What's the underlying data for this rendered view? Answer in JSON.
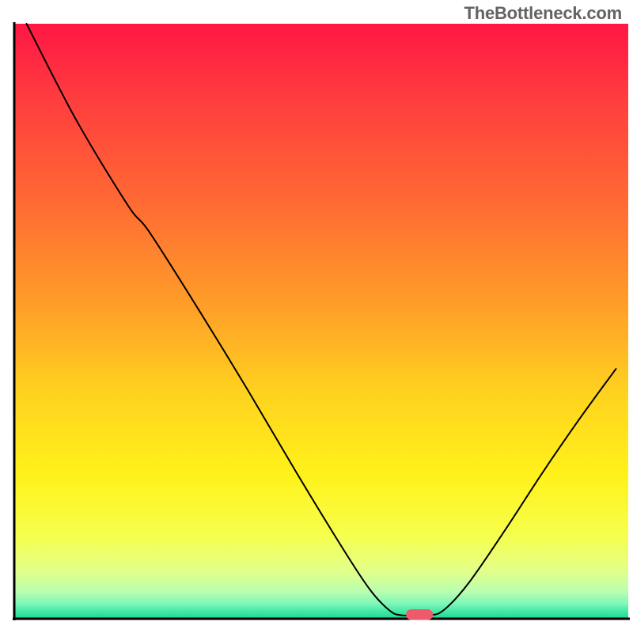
{
  "watermark": "TheBottleneck.com",
  "chart_data": {
    "type": "line",
    "title": "",
    "xlabel": "",
    "ylabel": "",
    "xlim": [
      0,
      100
    ],
    "ylim": [
      0,
      100
    ],
    "grid": false,
    "legend": false,
    "axes": {
      "left": true,
      "bottom": true,
      "right": false,
      "top": false
    },
    "background_gradient_stops": [
      {
        "offset": 0.0,
        "color": "#ff1744"
      },
      {
        "offset": 0.12,
        "color": "#ff3b3f"
      },
      {
        "offset": 0.3,
        "color": "#ff6a33"
      },
      {
        "offset": 0.48,
        "color": "#ffa028"
      },
      {
        "offset": 0.62,
        "color": "#ffd21f"
      },
      {
        "offset": 0.76,
        "color": "#fff21a"
      },
      {
        "offset": 0.86,
        "color": "#f6ff4d"
      },
      {
        "offset": 0.92,
        "color": "#e2ff8a"
      },
      {
        "offset": 0.955,
        "color": "#b8ffb0"
      },
      {
        "offset": 0.975,
        "color": "#7cf7b8"
      },
      {
        "offset": 0.99,
        "color": "#39e6a0"
      },
      {
        "offset": 1.0,
        "color": "#1fd68f"
      }
    ],
    "series": [
      {
        "name": "bottleneck-curve",
        "stroke": "#000000",
        "stroke_width": 2,
        "points": [
          {
            "x": 2.0,
            "y": 100.0
          },
          {
            "x": 10.0,
            "y": 84.0
          },
          {
            "x": 18.5,
            "y": 69.5
          },
          {
            "x": 22.0,
            "y": 65.0
          },
          {
            "x": 30.0,
            "y": 52.0
          },
          {
            "x": 38.0,
            "y": 38.5
          },
          {
            "x": 46.0,
            "y": 24.5
          },
          {
            "x": 54.0,
            "y": 11.0
          },
          {
            "x": 58.0,
            "y": 4.8
          },
          {
            "x": 61.0,
            "y": 1.5
          },
          {
            "x": 63.0,
            "y": 0.6
          },
          {
            "x": 67.5,
            "y": 0.6
          },
          {
            "x": 70.0,
            "y": 1.5
          },
          {
            "x": 74.0,
            "y": 6.0
          },
          {
            "x": 80.0,
            "y": 15.0
          },
          {
            "x": 86.0,
            "y": 24.5
          },
          {
            "x": 92.0,
            "y": 33.5
          },
          {
            "x": 98.0,
            "y": 42.0
          }
        ]
      }
    ],
    "marker": {
      "name": "optimal-point",
      "x": 66.0,
      "y": 0.7,
      "rx": 2.2,
      "ry": 0.9,
      "color": "#ef5a6a"
    }
  }
}
